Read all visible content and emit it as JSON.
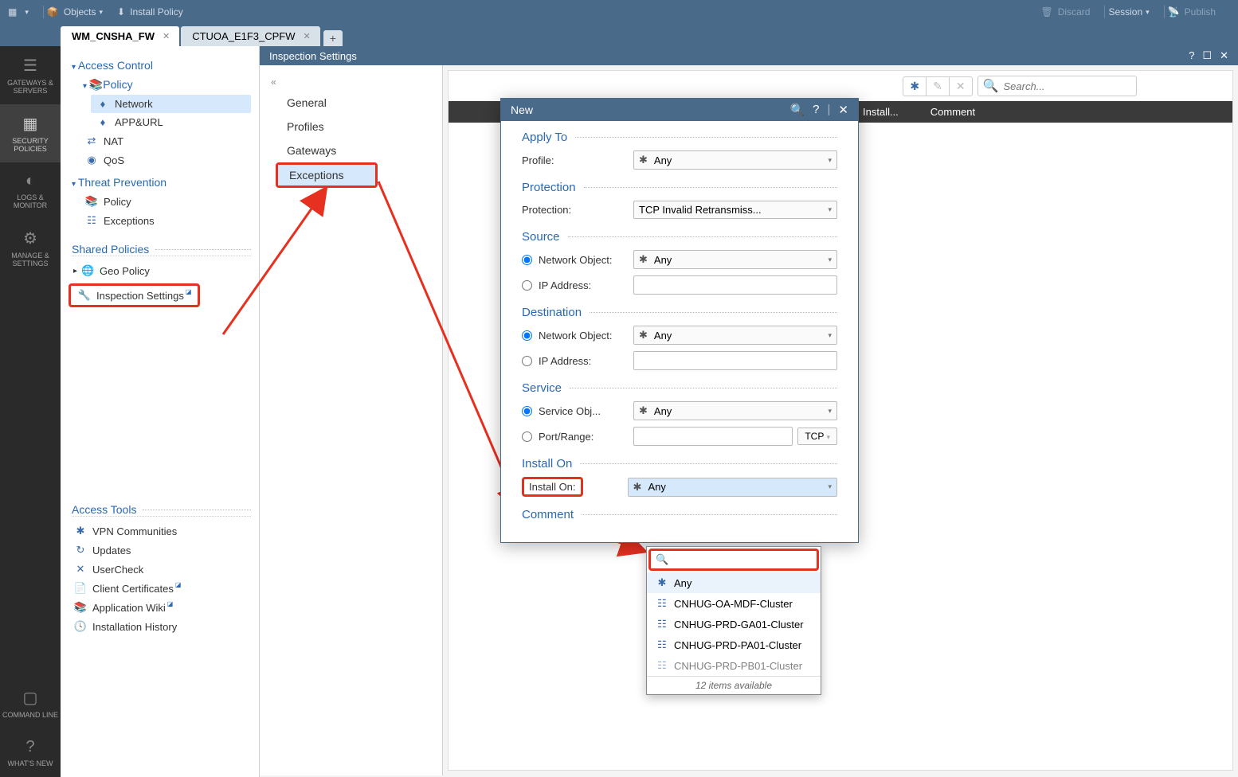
{
  "toolbar": {
    "objects": "Objects",
    "install_policy": "Install Policy",
    "discard": "Discard",
    "session": "Session",
    "publish": "Publish"
  },
  "tabs": [
    {
      "label": "WM_CNSHA_FW",
      "active": true
    },
    {
      "label": "CTUOA_E1F3_CPFW",
      "active": false
    }
  ],
  "rail": [
    {
      "label": "GATEWAYS & SERVERS"
    },
    {
      "label": "SECURITY POLICIES"
    },
    {
      "label": "LOGS & MONITOR"
    },
    {
      "label": "MANAGE & SETTINGS"
    },
    {
      "label": "COMMAND LINE"
    },
    {
      "label": "WHAT'S NEW"
    }
  ],
  "sidebar": {
    "access_control": "Access Control",
    "policy": "Policy",
    "network": "Network",
    "app_url": "APP&URL",
    "nat": "NAT",
    "qos": "QoS",
    "threat_prevention": "Threat Prevention",
    "tp_policy": "Policy",
    "tp_exceptions": "Exceptions",
    "shared_policies": "Shared Policies",
    "geo_policy": "Geo Policy",
    "inspection_settings": "Inspection Settings",
    "access_tools": "Access Tools",
    "vpn_communities": "VPN Communities",
    "updates": "Updates",
    "usercheck": "UserCheck",
    "client_certificates": "Client Certificates",
    "application_wiki": "Application Wiki",
    "installation_history": "Installation History"
  },
  "main": {
    "title": "Inspection Settings",
    "settings_menu": [
      "General",
      "Profiles",
      "Gateways",
      "Exceptions"
    ],
    "search_placeholder": "Search...",
    "table_headers": [
      "Install...",
      "Comment"
    ]
  },
  "dialog": {
    "title": "New",
    "sections": {
      "apply_to": {
        "title": "Apply To",
        "profile_label": "Profile:",
        "profile_value": "Any"
      },
      "protection": {
        "title": "Protection",
        "label": "Protection:",
        "value": "TCP Invalid Retransmiss..."
      },
      "source": {
        "title": "Source",
        "network_object": "Network Object:",
        "no_value": "Any",
        "ip_address": "IP Address:"
      },
      "destination": {
        "title": "Destination",
        "network_object": "Network Object:",
        "no_value": "Any",
        "ip_address": "IP Address:"
      },
      "service": {
        "title": "Service",
        "service_obj": "Service Obj...",
        "so_value": "Any",
        "port_range": "Port/Range:",
        "tcp": "TCP"
      },
      "install_on": {
        "title": "Install On",
        "label": "Install On:",
        "value": "Any"
      },
      "comment": {
        "title": "Comment"
      }
    }
  },
  "dropdown": {
    "items": [
      {
        "icon": "star",
        "label": "Any"
      },
      {
        "icon": "cluster",
        "label": "CNHUG-OA-MDF-Cluster"
      },
      {
        "icon": "cluster",
        "label": "CNHUG-PRD-GA01-Cluster"
      },
      {
        "icon": "cluster",
        "label": "CNHUG-PRD-PA01-Cluster"
      },
      {
        "icon": "cluster",
        "label": "CNHUG-PRD-PB01-Cluster"
      }
    ],
    "footer": "12 items available"
  }
}
